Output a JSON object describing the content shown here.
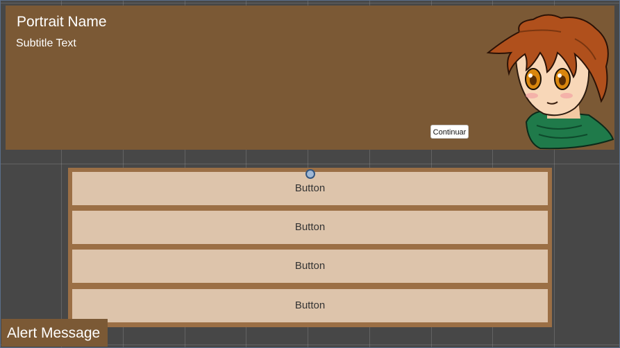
{
  "dialog": {
    "portrait_name": "Portrait Name",
    "subtitle": "Subtitle Text",
    "continue_label": "Continuar",
    "portrait_image": "anime-character-portrait"
  },
  "choices": {
    "buttons": [
      "Button",
      "Button",
      "Button",
      "Button"
    ]
  },
  "alert": {
    "message": "Alert Message"
  },
  "colors": {
    "canvas_background": "#474747",
    "panel_brown": "#7b5935",
    "button_panel_brown": "#9b6f45",
    "button_fill": "#ddc4ab"
  }
}
